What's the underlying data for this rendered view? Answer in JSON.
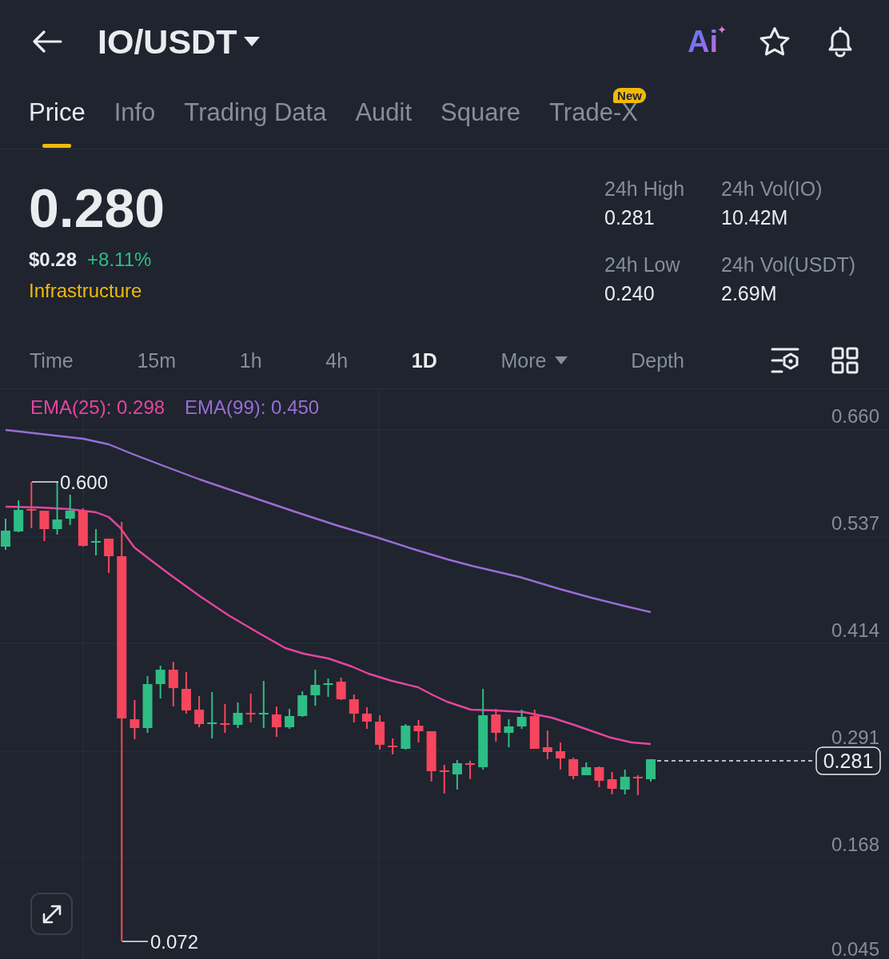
{
  "header": {
    "title": "IO/USDT",
    "assistant_label": "Ai"
  },
  "tabs": [
    {
      "label": "Price",
      "selected": true
    },
    {
      "label": "Info",
      "selected": false
    },
    {
      "label": "Trading Data",
      "selected": false
    },
    {
      "label": "Audit",
      "selected": false
    },
    {
      "label": "Square",
      "selected": false
    },
    {
      "label": "Trade-X",
      "selected": false,
      "badge": "New"
    }
  ],
  "ticker": {
    "price": "0.280",
    "price_usd": "$0.28",
    "change": "+8.11%",
    "rising": true,
    "sector": "Infrastructure"
  },
  "stats": [
    {
      "label": "24h High",
      "value": "0.281"
    },
    {
      "label": "24h Vol(IO)",
      "value": "10.42M"
    },
    {
      "label": "24h Low",
      "value": "0.240"
    },
    {
      "label": "24h Vol(USDT)",
      "value": "2.69M"
    }
  ],
  "intervals": [
    {
      "label": "Time",
      "kind": "option",
      "selected": false
    },
    {
      "label": "15m",
      "kind": "option",
      "selected": false
    },
    {
      "label": "1h",
      "kind": "option",
      "selected": false
    },
    {
      "label": "4h",
      "kind": "option",
      "selected": false
    },
    {
      "label": "1D",
      "kind": "option",
      "selected": true
    },
    {
      "label": "More",
      "kind": "dropdown",
      "selected": false
    },
    {
      "label": "Depth",
      "kind": "option",
      "selected": false
    }
  ],
  "chart": {
    "indicators": [
      {
        "label": "EMA(25): 0.298",
        "color": "#e5459f"
      },
      {
        "label": "EMA(99): 0.450",
        "color": "#9a6dd6"
      }
    ],
    "y_axis_labels": [
      "0.660",
      "0.537",
      "0.414",
      "0.291",
      "0.168",
      "0.045"
    ],
    "high_label": "0.600",
    "low_label": "0.072",
    "last_price": "0.281"
  }
}
